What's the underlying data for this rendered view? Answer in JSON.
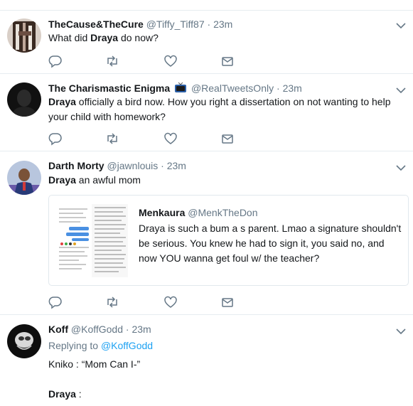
{
  "top_sliver": {
    "name": " ",
    "handle": " "
  },
  "tweets": [
    {
      "name": "TheCause&TheCure",
      "handle": "@Tiffy_Tiff87",
      "time": "23m",
      "text_pre": "What did ",
      "text_bold": "Draya",
      "text_post": " do now?"
    },
    {
      "name": "The Charismastic Enigma",
      "handle": "@RealTweetsOnly",
      "time": "23m",
      "text_bold": "Draya",
      "line1_post": " officially a bird now. How you right a dissertation on not wanting to help",
      "line2": "your child with homework?"
    },
    {
      "name": "Darth Morty",
      "handle": "@jawnlouis",
      "time": "23m",
      "text_bold": "Draya",
      "text_post": " an awful mom",
      "quote": {
        "name": "Menkaura",
        "handle": "@MenkTheDon",
        "text": "Draya is such a bum a  s parent. Lmao a signature shouldn't be serious. You knew he had to sign it, you said no, and now YOU wanna get foul w/ the teacher?"
      }
    },
    {
      "name": "Koff",
      "handle": "@KoffGodd",
      "time": "23m",
      "replying_label": "Replying to",
      "replying_handle": "@KoffGodd",
      "line1": "Kniko : “Mom Can I-”",
      "line2_bold": "Draya",
      "line2_post": " :"
    }
  ],
  "dot": "·",
  "icons": {
    "reply": "reply-icon",
    "retweet": "retweet-icon",
    "like": "heart-icon",
    "dm": "envelope-icon",
    "caret": "chevron-down-icon",
    "tv": "tv-emoji-icon"
  },
  "colors": {
    "name": "#14171a",
    "meta": "#657786",
    "link": "#1da1f2",
    "divider": "#e6ecf0"
  }
}
